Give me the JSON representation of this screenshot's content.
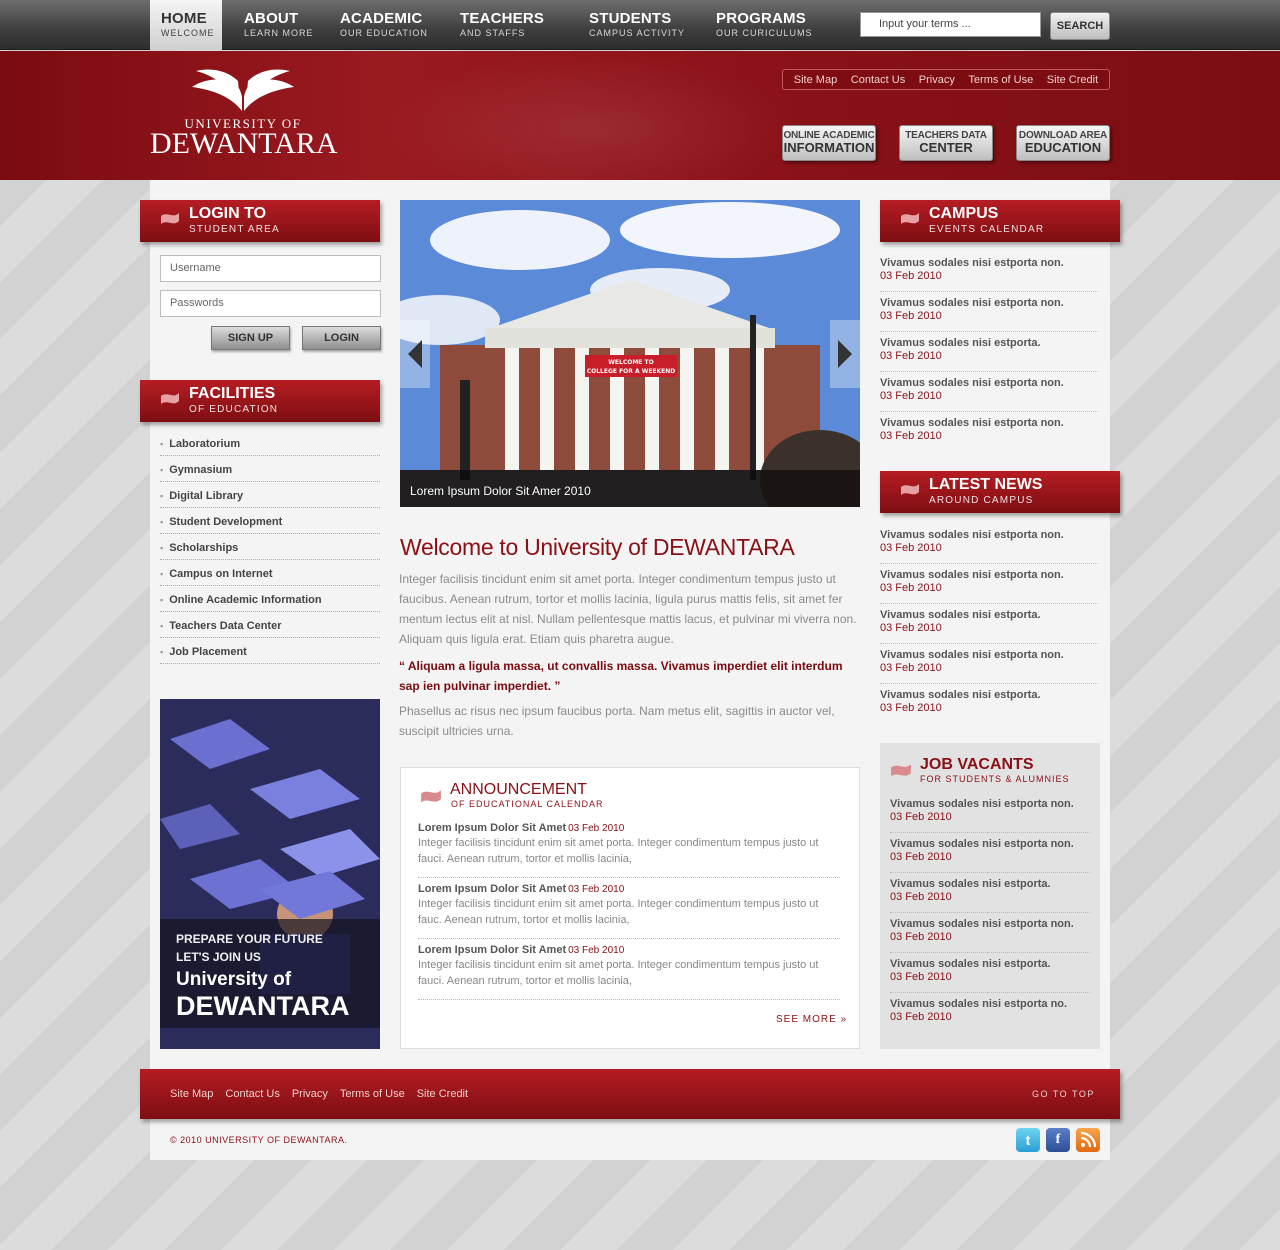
{
  "nav": {
    "items": [
      {
        "label": "HOME",
        "sub": "WELCOME"
      },
      {
        "label": "ABOUT",
        "sub": "LEARN MORE"
      },
      {
        "label": "ACADEMIC",
        "sub": "OUR EDUCATION"
      },
      {
        "label": "TEACHERS",
        "sub": "AND STAFFS"
      },
      {
        "label": "STUDENTS",
        "sub": "CAMPUS ACTIVITY"
      },
      {
        "label": "PROGRAMS",
        "sub": "OUR CURICULUMS"
      }
    ],
    "search_placeholder": "Input your terms ...",
    "search_button": "SEARCH"
  },
  "header": {
    "logo_small": "UNIVERSITY OF",
    "logo_big": "DEWANTARA",
    "util_links": [
      "Site Map",
      "Contact Us",
      "Privacy",
      "Terms of Use",
      "Site Credit"
    ],
    "buttons": [
      {
        "top": "ONLINE ACADEMIC",
        "bottom": "INFORMATION"
      },
      {
        "top": "TEACHERS DATA",
        "bottom": "CENTER"
      },
      {
        "top": "DOWNLOAD AREA",
        "bottom": "EDUCATION"
      }
    ]
  },
  "login": {
    "title": "LOGIN TO",
    "subtitle": "STUDENT AREA",
    "username_placeholder": "Username",
    "password_placeholder": "Passwords",
    "signup": "SIGN UP",
    "login": "LOGIN"
  },
  "facilities": {
    "title": "FACILITIES",
    "subtitle": "OF EDUCATION",
    "items": [
      "Laboratorium",
      "Gymnasium",
      "Digital Library",
      "Student Development",
      "Scholarships",
      "Campus on Internet",
      "Online Academic Information",
      "Teachers Data Center",
      "Job Placement"
    ]
  },
  "promo": {
    "line1": "PREPARE YOUR FUTURE",
    "line2": "LET'S JOIN US",
    "line3": "University of",
    "line4": "DEWANTARA"
  },
  "slider": {
    "caption": "Lorem Ipsum Dolor Sit Amer 2010",
    "banner_text1": "WELCOME TO",
    "banner_text2": "COLLEGE FOR A WEEKEND"
  },
  "welcome": {
    "title": "Welcome to University of DEWANTARA",
    "para1": "Integer facilisis tincidunt enim sit amet porta. Integer condimentum tempus justo ut faucibus. Aenean rutrum, tortor et mollis lacinia, ligula purus mattis felis, sit amet fer mentum lectus elit at nisl. Nullam pellentesque mattis lacus, et pulvinar mi viverra non. Aliquam quis ligula erat. Etiam quis pharetra augue.",
    "quote": "“ Aliquam a ligula massa, ut convallis massa. Vivamus imperdiet elit interdum sap ien pulvinar imperdiet. ”",
    "para2": "Phasellus ac risus nec ipsum faucibus porta. Nam metus elit, sagittis in auctor vel, suscipit ultricies urna."
  },
  "announcement": {
    "title": "ANNOUNCEMENT",
    "subtitle": "OF EDUCATIONAL CALENDAR",
    "items": [
      {
        "title": "Lorem Ipsum Dolor Sit Amet",
        "date": "03 Feb 2010",
        "text": "Integer facilisis tincidunt enim sit amet porta. Integer condimentum tempus justo ut fauci. Aenean rutrum, tortor et mollis lacinia,"
      },
      {
        "title": "Lorem Ipsum Dolor Sit Amet",
        "date": "03 Feb 2010",
        "text": "Integer facilisis tincidunt enim sit amet porta. Integer condimentum tempus justo ut fauc. Aenean rutrum, tortor et mollis lacinia,"
      },
      {
        "title": "Lorem Ipsum Dolor Sit Amet",
        "date": "03 Feb 2010",
        "text": "Integer facilisis tincidunt enim sit amet porta. Integer condimentum tempus justo ut fauci. Aenean rutrum, tortor et mollis lacinia,"
      }
    ],
    "see_more": "SEE MORE »"
  },
  "campus": {
    "title": "CAMPUS",
    "subtitle": "EVENTS CALENDAR",
    "items": [
      {
        "title": "Vivamus sodales nisi estporta non.",
        "date": "03 Feb 2010"
      },
      {
        "title": "Vivamus sodales nisi estporta non.",
        "date": "03 Feb 2010"
      },
      {
        "title": "Vivamus sodales nisi estporta.",
        "date": "03 Feb 2010"
      },
      {
        "title": "Vivamus sodales nisi estporta non.",
        "date": "03 Feb 2010"
      },
      {
        "title": "Vivamus sodales nisi estporta non.",
        "date": "03 Feb 2010"
      }
    ]
  },
  "news": {
    "title": "LATEST NEWS",
    "subtitle": "AROUND CAMPUS",
    "items": [
      {
        "title": "Vivamus sodales nisi estporta non.",
        "date": "03 Feb 2010"
      },
      {
        "title": "Vivamus sodales nisi estporta non.",
        "date": "03 Feb 2010"
      },
      {
        "title": "Vivamus sodales nisi estporta.",
        "date": "03 Feb 2010"
      },
      {
        "title": "Vivamus sodales nisi estporta non.",
        "date": "03 Feb 2010"
      },
      {
        "title": "Vivamus sodales nisi estporta.",
        "date": "03 Feb 2010"
      }
    ]
  },
  "jobs": {
    "title": "JOB VACANTS",
    "subtitle": "FOR STUDENTS & ALUMNIES",
    "items": [
      {
        "title": "Vivamus sodales nisi estporta non.",
        "date": "03 Feb 2010"
      },
      {
        "title": "Vivamus sodales nisi estporta non.",
        "date": "03 Feb 2010"
      },
      {
        "title": "Vivamus sodales nisi estporta.",
        "date": "03 Feb 2010"
      },
      {
        "title": "Vivamus sodales nisi estporta non.",
        "date": "03 Feb 2010"
      },
      {
        "title": "Vivamus sodales nisi estporta.",
        "date": "03 Feb 2010"
      },
      {
        "title": "Vivamus sodales nisi estporta no.",
        "date": "03 Feb 2010"
      }
    ]
  },
  "footer": {
    "links": [
      "Site Map",
      "Contact Us",
      "Privacy",
      "Terms of Use",
      "Site Credit"
    ],
    "gotop": "GO TO TOP",
    "copyright": "© 2010 UNIVERSITY OF DEWANTARA.",
    "social": [
      "twitter-icon",
      "facebook-icon",
      "rss-icon"
    ]
  },
  "colors": {
    "brand": "#8a1016",
    "ribbon_top": "#b51d23",
    "ribbon_bottom": "#7d0e12"
  }
}
